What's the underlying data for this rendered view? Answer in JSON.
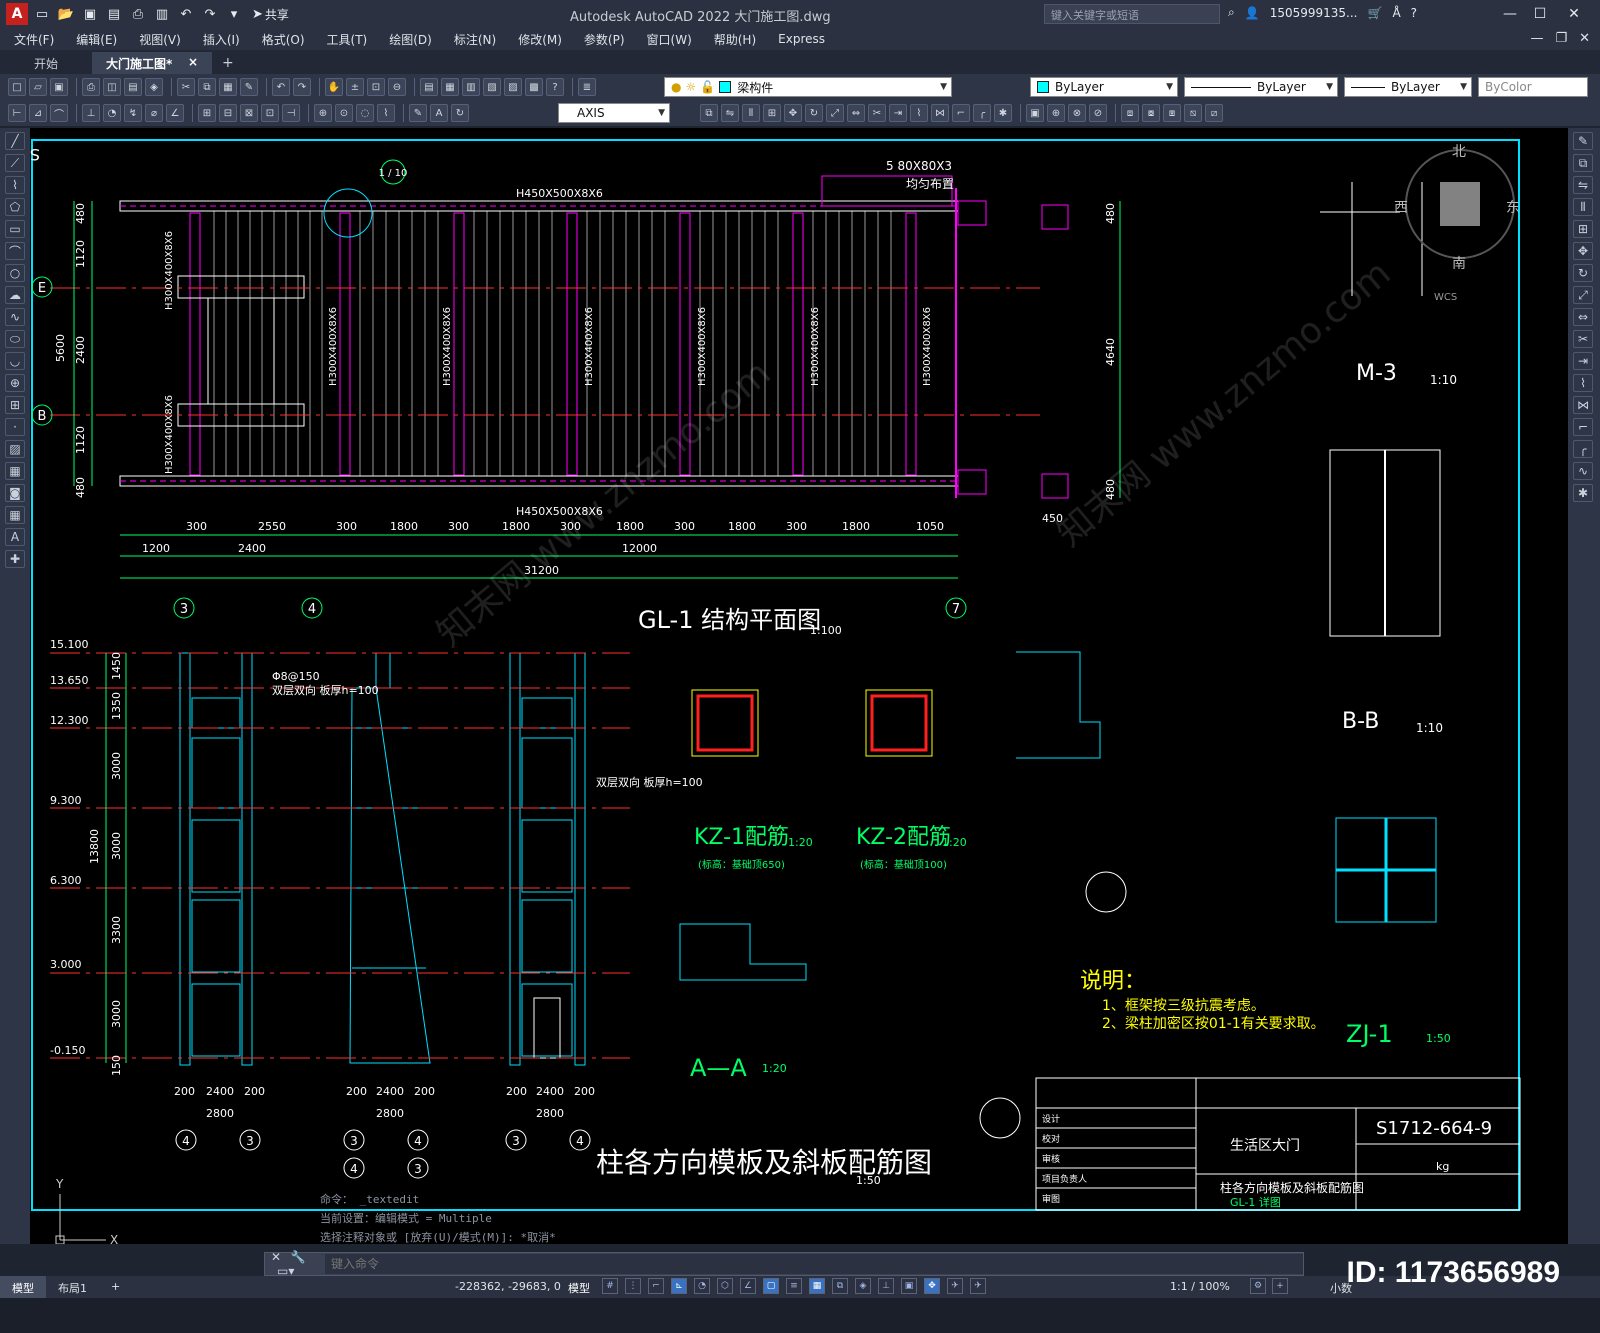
{
  "app": {
    "logo": "A",
    "title": "Autodesk AutoCAD 2022    大门施工图.dwg",
    "share_label": "共享",
    "search_placeholder": "键入关键字或短语",
    "user": "1505999135...",
    "window_controls": {
      "minimize": "—",
      "maximize": "☐",
      "close": "✕"
    }
  },
  "menu": {
    "items": [
      "文件(F)",
      "编辑(E)",
      "视图(V)",
      "插入(I)",
      "格式(O)",
      "工具(T)",
      "绘图(D)",
      "标注(N)",
      "修改(M)",
      "参数(P)",
      "窗口(W)",
      "帮助(H)",
      "Express"
    ]
  },
  "tabs": {
    "start": "开始",
    "active": "大门施工图*",
    "close": "×",
    "add": "+"
  },
  "toolbar": {
    "layer_name": "梁构件",
    "color": "ByLayer",
    "linetype": "ByLayer",
    "lineweight": "ByLayer",
    "plotstyle": "ByColor",
    "dimstyle": "AXIS"
  },
  "drawing": {
    "frame_color": "#00e0ff",
    "sheet_number": "S1712-664-9",
    "view_titles": {
      "plan": "GL-1 结构平面图",
      "plan_scale": "1:100",
      "elevation": "柱各方向模板及斜板配筋图",
      "elevation_scale": "1:50",
      "kz1": "KZ-1配筋",
      "kz1_scale": "1:20",
      "kz1_note": "(标高：基础顶650)",
      "kz2": "KZ-2配筋",
      "kz2_scale": "1:20",
      "kz2_note": "(标高：基础顶100)",
      "aa": "A—A",
      "aa_scale": "1:20",
      "m3": "M-3",
      "m3_scale": "1:10",
      "bb": "B-B",
      "bb_scale": "1:10",
      "zj1": "ZJ-1",
      "zj1_scale": "1:50"
    },
    "plan_beam_top": "H450X500X8X6",
    "plan_beam_bottom": "H450X500X8X6",
    "plan_column_label": "H300X400X8X6",
    "plan_note_a": "5  80X80X3",
    "plan_note_b": "均匀布置",
    "plan_dims_row1": [
      "300",
      "2550",
      "300",
      "1800",
      "300",
      "1800",
      "300",
      "1800",
      "300",
      "1800",
      "300",
      "1800",
      "1050"
    ],
    "plan_dims_row2": [
      "1200",
      "2400",
      "12000"
    ],
    "plan_dim_total": "31200",
    "plan_dims_left": [
      "480",
      "1120",
      "2400",
      "1120",
      "480"
    ],
    "plan_dim_left_total": "5600",
    "plan_dims_right": [
      "480",
      "4640",
      "480"
    ],
    "plan_dim_450": "450",
    "plan_axes_bottom": [
      "3",
      "4",
      "7"
    ],
    "plan_axes_left": [
      "E",
      "B"
    ],
    "plan_detail_tag": "1 / 10",
    "elevations": [
      "15.100",
      "13.650",
      "12.300",
      "9.300",
      "6.300",
      "3.000",
      "-0.150"
    ],
    "elev_dims": [
      "1450",
      "1350",
      "3000",
      "3000",
      "3300",
      "3000",
      "150"
    ],
    "elev_total": "13800",
    "elev_bottom_dims": [
      "200",
      "2400",
      "200"
    ],
    "elev_bottom_total": "2800",
    "elev_axes": [
      [
        "4",
        "3"
      ],
      [
        "3",
        "4",
        "4",
        "3"
      ],
      [
        "3",
        "4"
      ]
    ],
    "elev_note": "双层双向 板厚h=100",
    "elev_note_bar": "Φ8@150",
    "notes_title": "说明：",
    "notes": [
      "1、框架按三级抗震考虑。",
      "2、梁柱加密区按01-1有关要求取。"
    ],
    "titleblock": {
      "project": "生活区大门",
      "drawing_title": "柱各方向模板及斜板配筋图",
      "drawing_sub": "GL-1 详图",
      "number": "S1712-664-9",
      "unit": "kg",
      "rows": [
        "设计",
        "校对",
        "审核",
        "项目负责人",
        "审图"
      ]
    },
    "watermark": "知末网 www.znzmo.com",
    "compass": {
      "north": "北",
      "south": "南",
      "east": "东",
      "west": "西",
      "wcs": "WCS"
    },
    "ucs": {
      "y": "Y",
      "x": "X"
    }
  },
  "command": {
    "history": [
      "命令： _textedit",
      "当前设置：编辑模式 = Multiple",
      "选择注释对象或 [放弃(U)/模式(M)]: *取消*"
    ],
    "placeholder": "键入命令"
  },
  "status": {
    "layout_tabs": [
      "模型",
      "布局1"
    ],
    "add_layout": "+",
    "coords": "-228362, -29683, 0",
    "mode": "模型",
    "scale": "1:1 / 100%",
    "units": "小数"
  },
  "watermark_id": "ID: 1173656989"
}
